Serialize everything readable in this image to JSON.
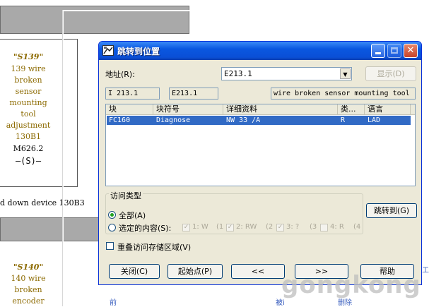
{
  "background": {
    "network1": {
      "symbol": "\"S139\"",
      "lines": [
        "139  wire",
        "broken",
        "sensor",
        "mounting",
        "tool",
        "adjustment",
        "130B1"
      ],
      "address": "M626.2",
      "coil": "—(S)—"
    },
    "caption": "d down device 130B3",
    "network2": {
      "symbol": "\"S140\"",
      "lines": [
        "140  wire",
        "broken",
        "encoder"
      ]
    },
    "bottom_labels": [
      "前",
      "被i",
      "删除",
      "工"
    ]
  },
  "dialog": {
    "title": "跳转到位置",
    "address_label": "地址(R):",
    "address_value": "E213.1",
    "display_button": "显示(D)",
    "info": {
      "type": "I    213.1",
      "operand": "E213.1",
      "comment": "wire broken sensor mounting tool"
    },
    "table": {
      "columns": [
        "块",
        "块符号",
        "详细资料",
        "类...",
        "语言"
      ],
      "rows": [
        {
          "block": "FC160",
          "symbol": "Diagnose",
          "details": "NW   33    /A",
          "type": "R",
          "language": "LAD"
        }
      ]
    },
    "access_group": {
      "title": "访问类型",
      "all_label": "全部(A)",
      "selected_label": "选定的内容(S):",
      "all_selected": true,
      "options": [
        {
          "label": "1: W",
          "key": "(1",
          "checked": true
        },
        {
          "label": "2: RW",
          "key": "(2",
          "checked": true
        },
        {
          "label": "3: ?",
          "key": "(3",
          "checked": true
        },
        {
          "label": "4: R",
          "key": "(4",
          "checked": false
        }
      ]
    },
    "goto_button": "跳转到(G)",
    "overlap_label": "重叠访问存储区域(V)",
    "overlap_checked": false,
    "buttons": {
      "close": "关闭(C)",
      "start": "起始点(P)",
      "prev": "<<",
      "next": ">>",
      "help": "帮助"
    }
  },
  "watermark": "gongkong",
  "colors": {
    "titlebar": "#0a57e0",
    "dialog_bg": "#ece9d8",
    "selection": "#316ac5",
    "ladder_text": "#8c6a00"
  }
}
